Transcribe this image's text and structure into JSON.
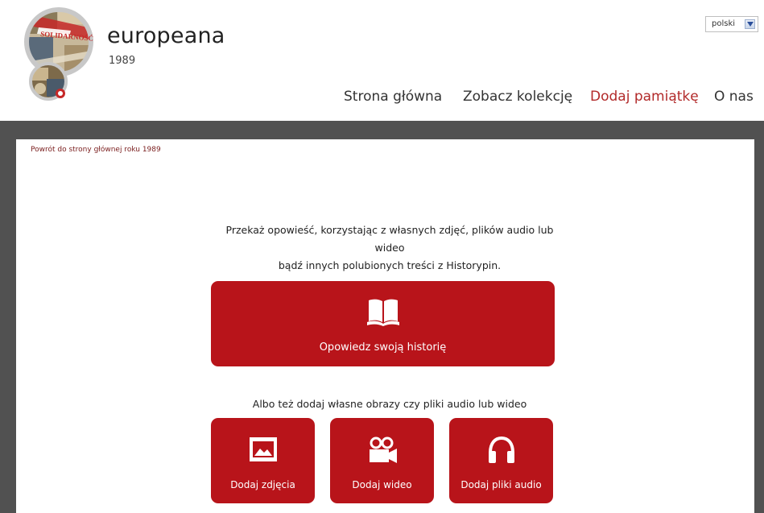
{
  "header": {
    "brand_name": "europeana",
    "brand_year": "1989",
    "logo_text": "SOLIDARNOŚĆ",
    "language": "polski"
  },
  "nav": {
    "items": [
      {
        "label": "Strona główna",
        "active": false
      },
      {
        "label": "Zobacz kolekcję",
        "active": false
      },
      {
        "label": "Dodaj pamiątkę",
        "active": true
      },
      {
        "label": "O nas",
        "active": false
      }
    ]
  },
  "main": {
    "back_link": "Powrót do strony głównej roku 1989",
    "intro_line1": "Przekaż opowieść, korzystając z własnych zdjęć, plików audio lub",
    "intro_line2": "wideo",
    "intro_line3": "bądź innych polubionych treści z Historypin.",
    "story_button": {
      "label": "Opowiedz swoją historię",
      "icon": "book-icon"
    },
    "alt_text": "Albo też dodaj własne obrazy czy pliki audio lub wideo",
    "upload_buttons": [
      {
        "label": "Dodaj zdjęcia",
        "icon": "image-icon"
      },
      {
        "label": "Dodaj wideo",
        "icon": "video-camera-icon"
      },
      {
        "label": "Dodaj pliki audio",
        "icon": "headphones-icon"
      }
    ]
  },
  "colors": {
    "accent_red": "#b8141a",
    "active_nav": "#b22a2a",
    "frame_gray": "#515151"
  }
}
